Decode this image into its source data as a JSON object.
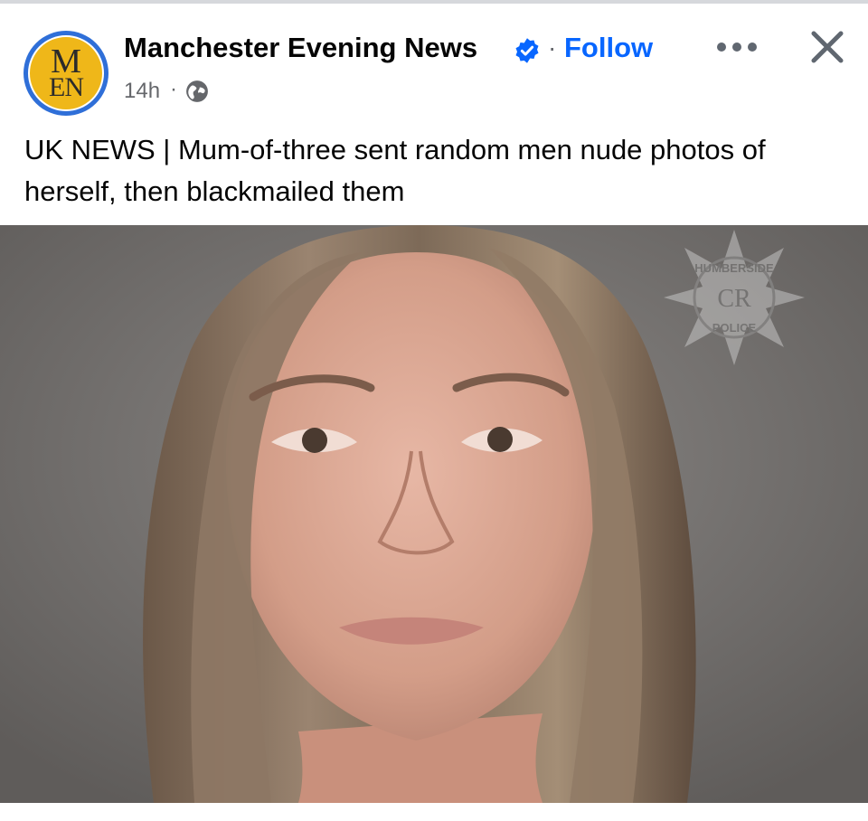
{
  "post": {
    "page_name": "Manchester Evening News",
    "separator": "·",
    "follow_label": "Follow",
    "timestamp": "14h",
    "timestamp_separator": "·",
    "audience_icon": "globe-icon",
    "verified_icon": "verified-badge-icon",
    "more_icon": "more-options-icon",
    "close_icon": "close-icon",
    "text": "UK NEWS | Mum-of-three sent random men nude photos of herself, then blackmailed them",
    "avatar": {
      "line1": "M",
      "line2": "EN"
    }
  },
  "colors": {
    "link": "#0866ff",
    "secondary_text": "#65676b",
    "avatar_ring": "#2f6fd8",
    "avatar_fill": "#efb719"
  },
  "image": {
    "description_icon": "photo-image",
    "watermark": {
      "top": "HUMBERSIDE",
      "bottom": "POLICE",
      "center": "CR"
    }
  }
}
